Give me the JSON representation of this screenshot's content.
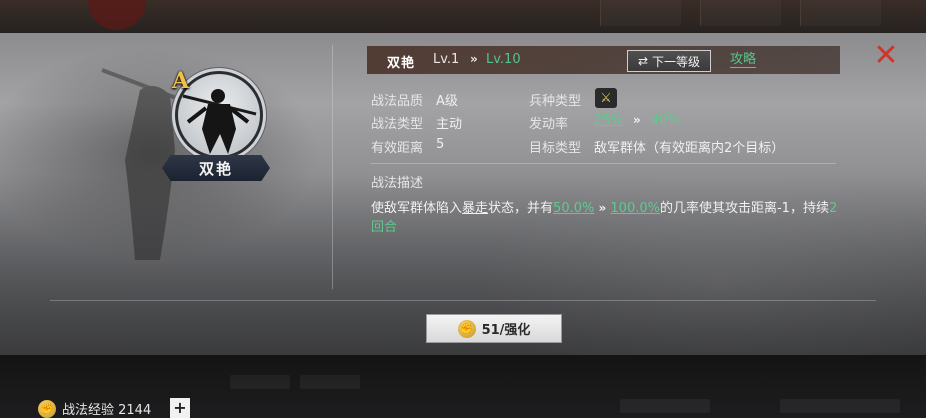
{
  "skill": {
    "grade": "A",
    "name": "双艳",
    "level_current": "Lv.1",
    "level_arrow": "»",
    "level_next": "Lv.10"
  },
  "header": {
    "next_level_button": "下一等级",
    "guide_link": "攻略",
    "close_icon": "✕"
  },
  "stats": {
    "quality_label": "战法品质",
    "quality_value": "A级",
    "troop_type_label": "兵种类型",
    "type_label": "战法类型",
    "type_value": "主动",
    "trigger_label": "发动率",
    "trigger_current": "25%",
    "trigger_arrow": "»",
    "trigger_next": "40%",
    "range_label": "有效距离",
    "range_value": "5",
    "target_label": "目标类型",
    "target_value": "敌军群体（有效距离内2个目标）"
  },
  "description": {
    "title": "战法描述",
    "part1": "使敌军群体陷入",
    "status": "暴走",
    "part2": "状态，并有",
    "rate_current": "50.0%",
    "arrow": "»",
    "rate_next": "100.0%",
    "part3": "的几率使其攻击距离-1，持续",
    "duration": "2回合"
  },
  "actions": {
    "strengthen_label": "51/强化"
  },
  "footer": {
    "exp_label": "战法经验 2144",
    "plus_label": "+"
  }
}
